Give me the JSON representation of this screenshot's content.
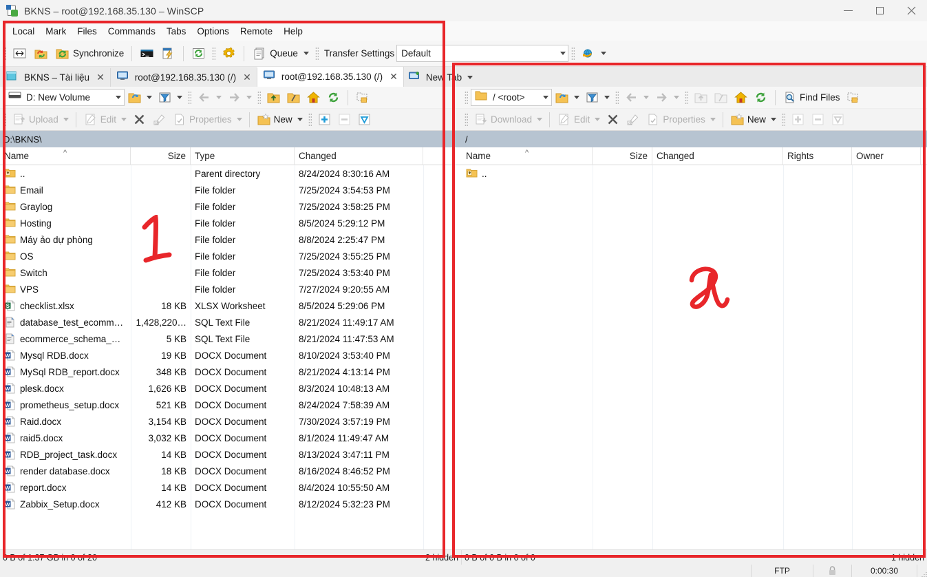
{
  "window": {
    "title": "BKNS – root@192.168.35.130 – WinSCP",
    "icon": "winscp-icon",
    "minimize": "—",
    "maximize": "□",
    "close": "✕"
  },
  "menubar": {
    "items": [
      "Local",
      "Mark",
      "Files",
      "Commands",
      "Tabs",
      "Options",
      "Remote",
      "Help"
    ]
  },
  "toolbar": {
    "synchronize_label": "Synchronize",
    "queue_label": "Queue",
    "transfer_settings_label": "Transfer Settings",
    "transfer_settings_value": "Default"
  },
  "tabs": {
    "items": [
      {
        "label": "BKNS – Tài liệu",
        "icon": "folder-tab-icon",
        "active": false,
        "close": "✕"
      },
      {
        "label": "root@192.168.35.130 (/)",
        "icon": "remote-tab-icon",
        "active": false,
        "close": "✕"
      },
      {
        "label": "root@192.168.35.130 (/)",
        "icon": "remote-tab-icon",
        "active": true,
        "close": "✕"
      }
    ],
    "new_tab_label": "New Tab"
  },
  "left_panel": {
    "drive_label": "D: New Volume",
    "drive_icon": "drive-icon",
    "path": "D:\\BKNS\\",
    "buttons": {
      "upload": "Upload",
      "edit": "Edit",
      "delete": "✕",
      "rename": "rename-icon",
      "properties": "Properties",
      "new": "New"
    },
    "columns": [
      "Name",
      "Size",
      "Type",
      "Changed"
    ],
    "rows": [
      {
        "name": "..",
        "icon": "parent-folder-icon",
        "size": "",
        "type": "Parent directory",
        "changed": "8/24/2024 8:30:16 AM"
      },
      {
        "name": "Email",
        "icon": "folder-icon",
        "size": "",
        "type": "File folder",
        "changed": "7/25/2024 3:54:53 PM"
      },
      {
        "name": "Graylog",
        "icon": "folder-icon",
        "size": "",
        "type": "File folder",
        "changed": "7/25/2024 3:58:25 PM"
      },
      {
        "name": "Hosting",
        "icon": "folder-icon",
        "size": "",
        "type": "File folder",
        "changed": "8/5/2024 5:29:12 PM"
      },
      {
        "name": "Máy ảo dự phòng",
        "icon": "folder-icon",
        "size": "",
        "type": "File folder",
        "changed": "8/8/2024 2:25:47 PM"
      },
      {
        "name": "OS",
        "icon": "folder-icon",
        "size": "",
        "type": "File folder",
        "changed": "7/25/2024 3:55:25 PM"
      },
      {
        "name": "Switch",
        "icon": "folder-icon",
        "size": "",
        "type": "File folder",
        "changed": "7/25/2024 3:53:40 PM"
      },
      {
        "name": "VPS",
        "icon": "folder-icon",
        "size": "",
        "type": "File folder",
        "changed": "7/27/2024 9:20:55 AM"
      },
      {
        "name": "checklist.xlsx",
        "icon": "xlsx-icon",
        "size": "18 KB",
        "type": "XLSX Worksheet",
        "changed": "8/5/2024 5:29:06 PM"
      },
      {
        "name": "database_test_ecomm…",
        "icon": "sql-icon",
        "size": "1,428,220…",
        "type": "SQL Text File",
        "changed": "8/21/2024 11:49:17 AM"
      },
      {
        "name": "ecommerce_schema_…",
        "icon": "sql-icon",
        "size": "5 KB",
        "type": "SQL Text File",
        "changed": "8/21/2024 11:47:53 AM"
      },
      {
        "name": "Mysql RDB.docx",
        "icon": "docx-icon",
        "size": "19 KB",
        "type": "DOCX Document",
        "changed": "8/10/2024 3:53:40 PM"
      },
      {
        "name": "MySql RDB_report.docx",
        "icon": "docx-icon",
        "size": "348 KB",
        "type": "DOCX Document",
        "changed": "8/21/2024 4:13:14 PM"
      },
      {
        "name": "plesk.docx",
        "icon": "docx-icon",
        "size": "1,626 KB",
        "type": "DOCX Document",
        "changed": "8/3/2024 10:48:13 AM"
      },
      {
        "name": "prometheus_setup.docx",
        "icon": "docx-icon",
        "size": "521 KB",
        "type": "DOCX Document",
        "changed": "8/24/2024 7:58:39 AM"
      },
      {
        "name": "Raid.docx",
        "icon": "docx-icon",
        "size": "3,154 KB",
        "type": "DOCX Document",
        "changed": "7/30/2024 3:57:19 PM"
      },
      {
        "name": "raid5.docx",
        "icon": "docx-icon",
        "size": "3,032 KB",
        "type": "DOCX Document",
        "changed": "8/1/2024 11:49:47 AM"
      },
      {
        "name": "RDB_project_task.docx",
        "icon": "docx-icon",
        "size": "14 KB",
        "type": "DOCX Document",
        "changed": "8/13/2024 3:47:11 PM"
      },
      {
        "name": "render database.docx",
        "icon": "docx-icon",
        "size": "18 KB",
        "type": "DOCX Document",
        "changed": "8/16/2024 8:46:52 PM"
      },
      {
        "name": "report.docx",
        "icon": "docx-icon",
        "size": "14 KB",
        "type": "DOCX Document",
        "changed": "8/4/2024 10:55:50 AM"
      },
      {
        "name": "Zabbix_Setup.docx",
        "icon": "docx-icon",
        "size": "412 KB",
        "type": "DOCX Document",
        "changed": "8/12/2024 5:32:23 PM"
      }
    ],
    "status": "0 B of 1.37 GB in 0 of 20",
    "hidden": "2 hidden"
  },
  "right_panel": {
    "root_label": "/ <root>",
    "root_icon": "folder-icon",
    "path": "/",
    "find_files_label": "Find Files",
    "buttons": {
      "download": "Download",
      "edit": "Edit",
      "delete": "✕",
      "rename": "rename-icon",
      "properties": "Properties",
      "new": "New"
    },
    "columns": [
      "Name",
      "Size",
      "Changed",
      "Rights",
      "Owner"
    ],
    "rows": [
      {
        "name": "..",
        "icon": "parent-folder-icon",
        "size": "",
        "changed": "",
        "rights": "",
        "owner": ""
      }
    ],
    "status": "0 B of 0 B in 0 of 0",
    "hidden": "1 hidden"
  },
  "statusbar": {
    "protocol": "FTP",
    "lock_icon": "lock-icon",
    "duration": "0:00:30"
  },
  "annotations": [
    {
      "label": "1",
      "target": "left-panel"
    },
    {
      "label": "2",
      "target": "right-panel"
    }
  ],
  "colors": {
    "annotation_red": "#e8262a",
    "path_bar": "#b7c4d1",
    "folder_yellow": "#f5c253",
    "word_blue": "#2b5797",
    "excel_green": "#1d7044"
  }
}
